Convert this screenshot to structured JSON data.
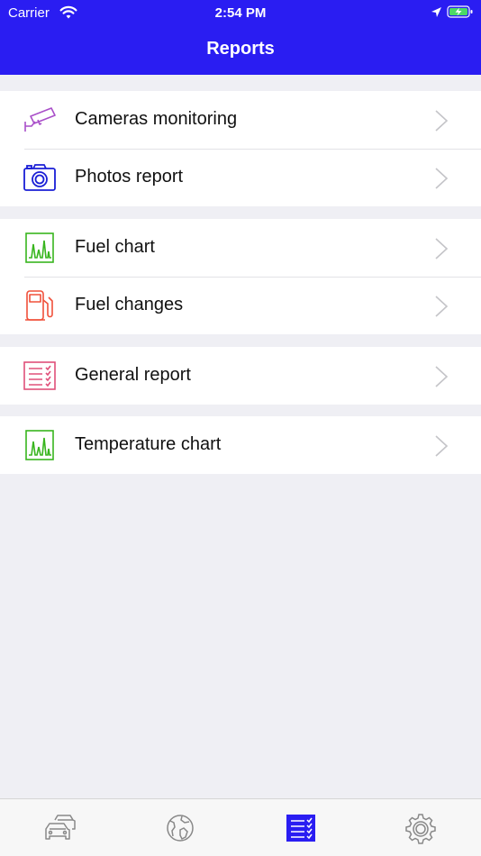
{
  "status_bar": {
    "carrier": "Carrier",
    "time": "2:54 PM"
  },
  "header": {
    "title": "Reports",
    "color": "#2a1df2"
  },
  "groups": [
    {
      "items": [
        {
          "label": "Cameras monitoring",
          "icon": "security-camera-icon"
        },
        {
          "label": "Photos report",
          "icon": "camera-icon"
        }
      ]
    },
    {
      "items": [
        {
          "label": "Fuel chart",
          "icon": "chart-icon"
        },
        {
          "label": "Fuel changes",
          "icon": "fuel-pump-icon"
        }
      ]
    },
    {
      "items": [
        {
          "label": "General report",
          "icon": "report-list-icon"
        }
      ]
    },
    {
      "items": [
        {
          "label": "Temperature chart",
          "icon": "chart-icon"
        }
      ]
    }
  ],
  "tabbar": {
    "tabs": [
      {
        "icon": "vehicles-icon",
        "selected": false
      },
      {
        "icon": "globe-map-icon",
        "selected": false
      },
      {
        "icon": "reports-icon",
        "selected": true
      },
      {
        "icon": "settings-gear-icon",
        "selected": false
      }
    ]
  },
  "colors": {
    "camera_icon": "#a94fc9",
    "photo_icon": "#1a1fd6",
    "chart_icon": "#38b51e",
    "fuel_icon": "#f0503a",
    "report_icon": "#e0507a",
    "tab_inactive": "#888888",
    "tab_active": "#2a1df2"
  }
}
